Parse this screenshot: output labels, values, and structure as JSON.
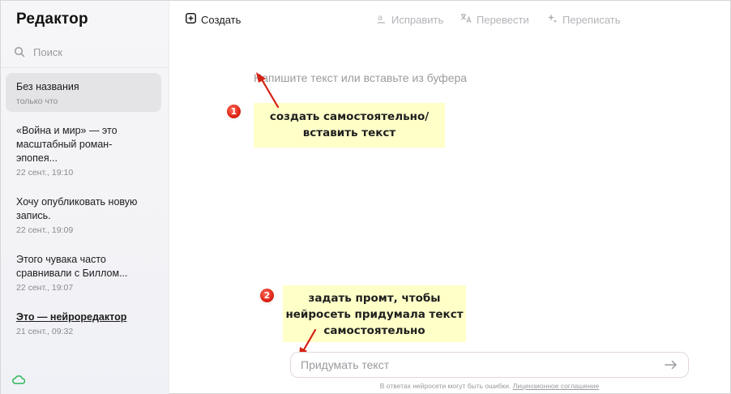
{
  "sidebar": {
    "app_title": "Редактор",
    "search_placeholder": "Поиск",
    "docs": [
      {
        "title": "Без названия",
        "time": "только что"
      },
      {
        "title": "«Война и мир» — это масштабный роман-эпопея...",
        "time": "22 сент., 19:10"
      },
      {
        "title": "Хочу опубликовать новую запись.",
        "time": "22 сент., 19:09"
      },
      {
        "title": "Этого чувака часто сравнивали с Биллом...",
        "time": "22 сент., 19:07"
      },
      {
        "title": "Это — нейроредактор",
        "time": "21 сент., 09:32"
      }
    ]
  },
  "toolbar": {
    "create_label": "Создать",
    "fix_label": "Исправить",
    "translate_label": "Перевести",
    "rewrite_label": "Переписать"
  },
  "editor": {
    "placeholder": "Напишите текст или вставьте из буфера"
  },
  "annotations": {
    "badge1": "1",
    "note1_line1": "создать самостоятельно/",
    "note1_line2": "вставить текст",
    "badge2": "2",
    "note2_line1": "задать промт, чтобы",
    "note2_line2": "нейросеть придумала текст",
    "note2_line3": "самостоятельно"
  },
  "prompt": {
    "placeholder": "Придумать текст",
    "disclaimer_text": "В ответах нейросети могут быть ошибки.",
    "disclaimer_link": "Лицензионное соглашение"
  },
  "colors": {
    "note_bg": "#ffffc8",
    "badge_red": "#e02a1a",
    "arrow_red": "#d42214",
    "cloud_green": "#2eb85c"
  }
}
